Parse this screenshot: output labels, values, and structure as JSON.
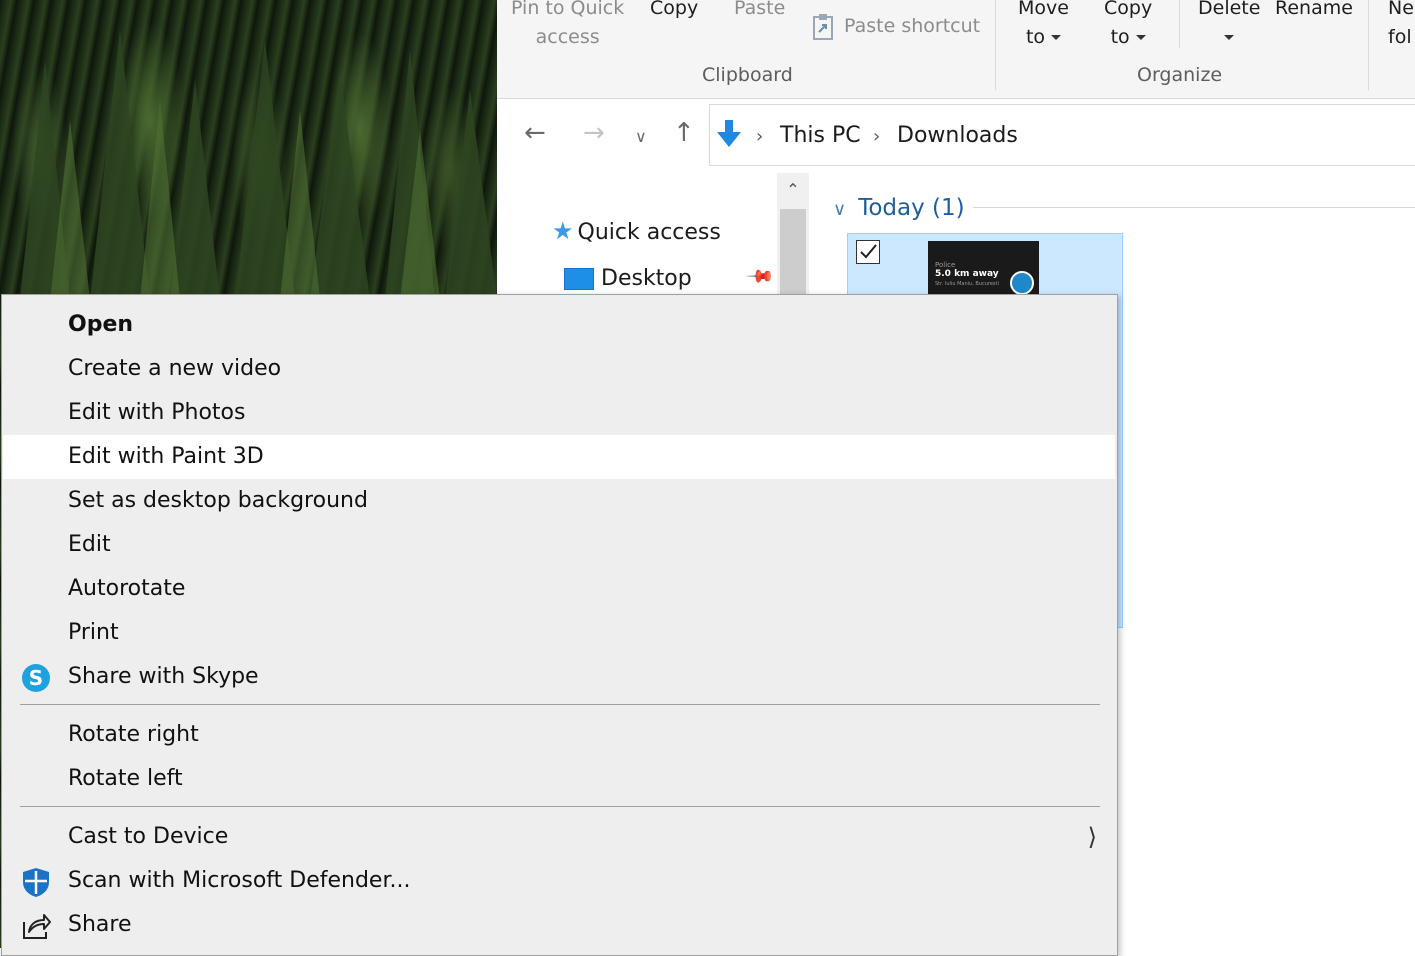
{
  "ribbon": {
    "pin_line1": "Pin to Quick",
    "pin_line2": "access",
    "copy": "Copy",
    "paste": "Paste",
    "paste_shortcut": "Paste shortcut",
    "clipboard_group": "Clipboard",
    "move_line1": "Move",
    "move_line2": "to",
    "copy_to_line1": "Copy",
    "copy_to_line2": "to",
    "delete": "Delete",
    "rename": "Rename",
    "new_folder_line1": "Ne",
    "new_folder_line2": "fol",
    "organize_group": "Organize"
  },
  "address": {
    "crumbs": [
      "This PC",
      "Downloads"
    ]
  },
  "nav_pane": {
    "items": [
      "Quick access",
      "Desktop"
    ]
  },
  "content": {
    "group_header": "Today (1)",
    "thumbnail": {
      "line1": "Police",
      "line2": "5.0 km away",
      "line3": "Str. Iuliu Maniu, Bucuresti"
    }
  },
  "context_menu": {
    "items": [
      "Open",
      "Create a new video",
      "Edit with Photos",
      "Edit with Paint 3D",
      "Set as desktop background",
      "Edit",
      "Autorotate",
      "Print",
      "Share with Skype",
      "Rotate right",
      "Rotate left",
      "Cast to Device",
      "Scan with Microsoft Defender...",
      "Share"
    ],
    "highlighted": "Edit with Paint 3D"
  },
  "colors": {
    "accent": "#1e88e5",
    "selection": "#cce8ff",
    "menu_bg": "#eeeeee",
    "group_header": "#1f5e9c"
  }
}
